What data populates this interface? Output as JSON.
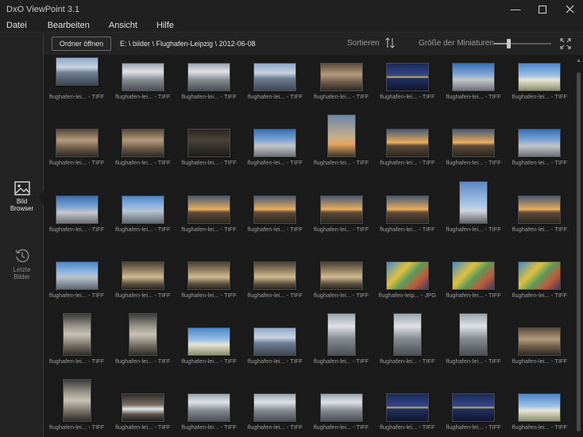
{
  "window": {
    "title": "DxO ViewPoint 3.1"
  },
  "menu": {
    "items": [
      "Datei",
      "Bearbeiten",
      "Ansicht",
      "Hilfe"
    ]
  },
  "sidebar": {
    "browser_label": "Bild Browser",
    "recent_label": "Letzte Bilder"
  },
  "toolbar": {
    "open_folder": "Ordner öffnen",
    "path": "E: \\ bilder \\ Flughafen-Leipzig \\ 2012-06-08",
    "sort_label": "Sortieren",
    "thumb_size_label": "Größe der Miniaturen",
    "thumb_size_fraction": 0.25
  },
  "colors": {
    "background": "#1b1b1b",
    "panel": "#232323"
  },
  "thumbnails": [
    {
      "caption": "flughafen-lei... - TIFF",
      "orient": "land",
      "scene": "hall-blue"
    },
    {
      "caption": "flughafen-lei... - TIFF",
      "orient": "land",
      "scene": "hall-gray"
    },
    {
      "caption": "flughafen-lei... - TIFF",
      "orient": "land",
      "scene": "hall-gray"
    },
    {
      "caption": "flughafen-lei... - TIFF",
      "orient": "land",
      "scene": "hall-blue"
    },
    {
      "caption": "flughafen-lei... - TIFF",
      "orient": "land",
      "scene": "interior-warm"
    },
    {
      "caption": "flughafen-lei... - TIFF",
      "orient": "land",
      "scene": "board"
    },
    {
      "caption": "flughafen-lei... - TIFF",
      "orient": "land",
      "scene": "terminal-sky"
    },
    {
      "caption": "flughafen-lei... - TIFF",
      "orient": "land",
      "scene": "plane-sky"
    },
    {
      "caption": "flughafen-lei... - TIFF",
      "orient": "land",
      "scene": "interior-warm"
    },
    {
      "caption": "flughafen-lei... - TIFF",
      "orient": "land",
      "scene": "interior-warm"
    },
    {
      "caption": "flughafen-lei... - TIFF",
      "orient": "land",
      "scene": "dark"
    },
    {
      "caption": "flughafen-lei... - TIFF",
      "orient": "land",
      "scene": "terminal-sky"
    },
    {
      "caption": "flughafen-lei... - TIFF",
      "orient": "port",
      "scene": "tower-sunset"
    },
    {
      "caption": "flughafen-lei... - TIFF",
      "orient": "land",
      "scene": "sunset-road"
    },
    {
      "caption": "flughafen-lei... - TIFF",
      "orient": "land",
      "scene": "sunset-road"
    },
    {
      "caption": "flughafen-lei... - TIFF",
      "orient": "land",
      "scene": "terminal-sky"
    },
    {
      "caption": "flughafen-lei... - TIFF",
      "orient": "land",
      "scene": "terminal-sky"
    },
    {
      "caption": "flughafen-lei... - TIFF",
      "orient": "land",
      "scene": "building-blue"
    },
    {
      "caption": "flughafen-lei... - TIFF",
      "orient": "land",
      "scene": "sunset-road"
    },
    {
      "caption": "flughafen-lei... - TIFF",
      "orient": "land",
      "scene": "sunset-road"
    },
    {
      "caption": "flughafen-lei... - TIFF",
      "orient": "land",
      "scene": "sunset-road"
    },
    {
      "caption": "flughafen-lei... - TIFF",
      "orient": "land",
      "scene": "sunset-road"
    },
    {
      "caption": "flughafen-lei... - TIFF",
      "orient": "port",
      "scene": "tower-sky"
    },
    {
      "caption": "flughafen-lei... - TIFF",
      "orient": "land",
      "scene": "sunset-road"
    },
    {
      "caption": "flughafen-lei... - TIFF",
      "orient": "land",
      "scene": "building-blue"
    },
    {
      "caption": "flughafen-lei... - TIFF",
      "orient": "land",
      "scene": "escalator"
    },
    {
      "caption": "flughafen-lei... - TIFF",
      "orient": "land",
      "scene": "escalator"
    },
    {
      "caption": "flughafen-lei... - TIFF",
      "orient": "land",
      "scene": "escalator"
    },
    {
      "caption": "flughafen-lei... - TIFF",
      "orient": "land",
      "scene": "escalator"
    },
    {
      "caption": "flughafen-leip... - JPG",
      "orient": "land",
      "scene": "colorful"
    },
    {
      "caption": "flughafen-lei... - TIFF",
      "orient": "land",
      "scene": "colorful"
    },
    {
      "caption": "flughafen-lei... - TIFF",
      "orient": "land",
      "scene": "colorful"
    },
    {
      "caption": "flughafen-lei... - TIFF",
      "orient": "port",
      "scene": "corridor"
    },
    {
      "caption": "flughafen-lei... - TIFF",
      "orient": "port",
      "scene": "corridor"
    },
    {
      "caption": "flughafen-lei... - TIFF",
      "orient": "land",
      "scene": "plane-sky"
    },
    {
      "caption": "flughafen-lei... - TIFF",
      "orient": "land",
      "scene": "hall-blue"
    },
    {
      "caption": "flughafen-lei... - TIFF",
      "orient": "port",
      "scene": "hall-gray"
    },
    {
      "caption": "flughafen-lei... - TIFF",
      "orient": "port",
      "scene": "hall-gray"
    },
    {
      "caption": "flughafen-lei... - TIFF",
      "orient": "port",
      "scene": "hall-gray"
    },
    {
      "caption": "flughafen-lei... - TIFF",
      "orient": "land",
      "scene": "interior-warm"
    },
    {
      "caption": "flughafen-lei... - TIFF",
      "orient": "port",
      "scene": "corridor"
    },
    {
      "caption": "flughafen-lei... - TIFF",
      "orient": "land",
      "scene": "car"
    },
    {
      "caption": "flughafen-lei... - TIFF",
      "orient": "land",
      "scene": "hall-gray"
    },
    {
      "caption": "flughafen-lei... - TIFF",
      "orient": "land",
      "scene": "hall-gray"
    },
    {
      "caption": "flughafen-lei... - TIFF",
      "orient": "land",
      "scene": "hall-gray"
    },
    {
      "caption": "flughafen-lei... - TIFF",
      "orient": "land",
      "scene": "board"
    },
    {
      "caption": "flughafen-lei... - TIFF",
      "orient": "land",
      "scene": "board"
    },
    {
      "caption": "flughafen-lei... - TIFF",
      "orient": "land",
      "scene": "plane-sky"
    }
  ]
}
